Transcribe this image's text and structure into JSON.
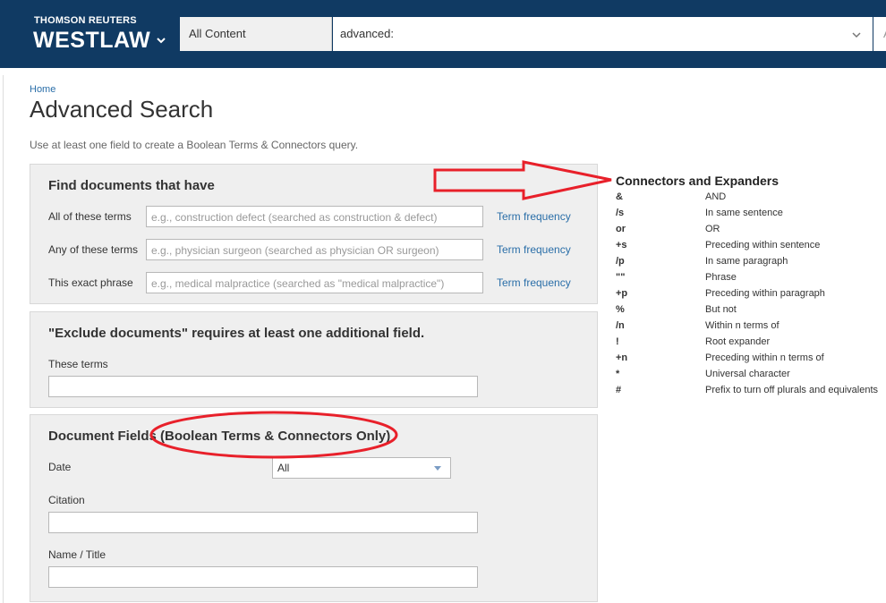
{
  "header": {
    "brand_top": "THOMSON REUTERS",
    "brand_main": "WESTLAW",
    "scope": "All Content",
    "query": "advanced:",
    "stub_text": "A",
    "bg_color": "#103a63"
  },
  "breadcrumb": "Home",
  "title": "Advanced Search",
  "intro": "Use at least one field to create a Boolean Terms & Connectors query.",
  "find_panel": {
    "heading": "Find documents that have",
    "rows": [
      {
        "label": "All of these terms",
        "placeholder": "e.g., construction defect (searched as construction & defect)",
        "link": "Term frequency"
      },
      {
        "label": "Any of these terms",
        "placeholder": "e.g., physician surgeon (searched as physician OR surgeon)",
        "link": "Term frequency"
      },
      {
        "label": "This exact phrase",
        "placeholder": "e.g., medical malpractice (searched as \"medical malpractice\")",
        "link": "Term frequency"
      }
    ]
  },
  "exclude_panel": {
    "heading": "\"Exclude documents\" requires at least one additional field.",
    "label": "These terms"
  },
  "fields_panel": {
    "heading": "Document Fields (Boolean Terms & Connectors Only)",
    "date_label": "Date",
    "date_value": "All",
    "citation_label": "Citation",
    "name_label": "Name / Title"
  },
  "connectors": {
    "title": "Connectors and Expanders",
    "items": [
      {
        "sym": "&",
        "desc": "AND"
      },
      {
        "sym": "/s",
        "desc": "In same sentence"
      },
      {
        "sym": "or",
        "desc": "OR"
      },
      {
        "sym": "+s",
        "desc": "Preceding within sentence"
      },
      {
        "sym": "/p",
        "desc": "In same paragraph"
      },
      {
        "sym": "\"\"",
        "desc": "Phrase"
      },
      {
        "sym": "+p",
        "desc": "Preceding within paragraph"
      },
      {
        "sym": "%",
        "desc": "But not"
      },
      {
        "sym": "/n",
        "desc": "Within n terms of"
      },
      {
        "sym": "!",
        "desc": "Root expander"
      },
      {
        "sym": "+n",
        "desc": "Preceding within n terms of"
      },
      {
        "sym": "*",
        "desc": "Universal character"
      },
      {
        "sym": "#",
        "desc": "Prefix to turn off plurals and equivalents"
      }
    ]
  },
  "annotation_color": "#e8202a",
  "link_color": "#2a6ea8"
}
